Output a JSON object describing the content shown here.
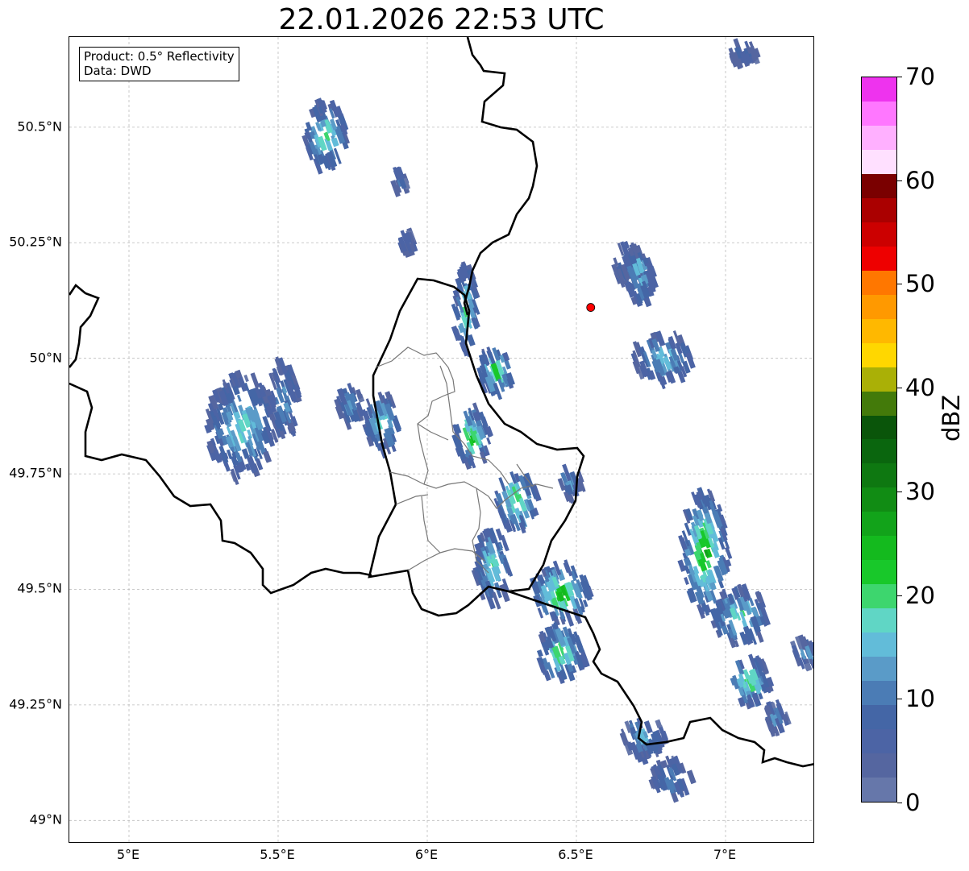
{
  "title": "22.01.2026 22:53 UTC",
  "info_box": {
    "product": "Product: 0.5° Reflectivity",
    "data_source": "Data: DWD"
  },
  "map_extent": {
    "lon_min": 4.8,
    "lon_max": 7.3,
    "lat_min": 48.95,
    "lat_max": 50.695
  },
  "lat_ticks": [
    {
      "value": 50.5,
      "label": "50.5°N"
    },
    {
      "value": 50.25,
      "label": "50.25°N"
    },
    {
      "value": 50.0,
      "label": "50°N"
    },
    {
      "value": 49.75,
      "label": "49.75°N"
    },
    {
      "value": 49.5,
      "label": "49.5°N"
    },
    {
      "value": 49.25,
      "label": "49.25°N"
    },
    {
      "value": 49.0,
      "label": "49°N"
    }
  ],
  "lon_ticks": [
    {
      "value": 5.0,
      "label": "5°E"
    },
    {
      "value": 5.5,
      "label": "5.5°E"
    },
    {
      "value": 6.0,
      "label": "6°E"
    },
    {
      "value": 6.5,
      "label": "6.5°E"
    },
    {
      "value": 7.0,
      "label": "7°E"
    }
  ],
  "radar_site": {
    "lon": 6.548,
    "lat": 50.11,
    "color": "#ff0000"
  },
  "colorbar": {
    "label": "dBZ",
    "min": 0,
    "max": 70,
    "ticks": [
      "0",
      "10",
      "20",
      "30",
      "40",
      "50",
      "60",
      "70"
    ],
    "colors": [
      "#6677aa",
      "#5566a0",
      "#4c64a5",
      "#4466a6",
      "#4b7cb5",
      "#5a9bc8",
      "#62bcd9",
      "#60d6c5",
      "#3dd66e",
      "#18c82a",
      "#14ba1e",
      "#12a31a",
      "#118c14",
      "#0e7811",
      "#0a660e",
      "#0a550a",
      "#437a0a",
      "#aab006",
      "#ffd700",
      "#ffb800",
      "#ff9900",
      "#ff7700",
      "#ee0000",
      "#cc0000",
      "#aa0000",
      "#7a0000",
      "#ffe0ff",
      "#ffb0ff",
      "#ff77ff",
      "#ee33ee"
    ]
  },
  "echo_clusters": [
    {
      "lon": 5.66,
      "lat": 50.48,
      "rx": 0.07,
      "ry": 0.07,
      "peak": 22
    },
    {
      "lon": 5.91,
      "lat": 50.38,
      "rx": 0.02,
      "ry": 0.03,
      "peak": 10
    },
    {
      "lon": 5.93,
      "lat": 50.25,
      "rx": 0.03,
      "ry": 0.02,
      "peak": 10
    },
    {
      "lon": 5.38,
      "lat": 49.85,
      "rx": 0.12,
      "ry": 0.11,
      "peak": 18
    },
    {
      "lon": 5.52,
      "lat": 49.91,
      "rx": 0.05,
      "ry": 0.08,
      "peak": 15
    },
    {
      "lon": 5.85,
      "lat": 49.86,
      "rx": 0.06,
      "ry": 0.06,
      "peak": 20
    },
    {
      "lon": 5.74,
      "lat": 49.9,
      "rx": 0.04,
      "ry": 0.04,
      "peak": 16
    },
    {
      "lon": 6.13,
      "lat": 50.1,
      "rx": 0.04,
      "ry": 0.1,
      "peak": 20
    },
    {
      "lon": 6.23,
      "lat": 49.97,
      "rx": 0.06,
      "ry": 0.05,
      "peak": 22
    },
    {
      "lon": 6.15,
      "lat": 49.83,
      "rx": 0.06,
      "ry": 0.06,
      "peak": 24
    },
    {
      "lon": 6.3,
      "lat": 49.69,
      "rx": 0.07,
      "ry": 0.06,
      "peak": 24
    },
    {
      "lon": 6.22,
      "lat": 49.55,
      "rx": 0.06,
      "ry": 0.08,
      "peak": 20
    },
    {
      "lon": 6.45,
      "lat": 49.49,
      "rx": 0.1,
      "ry": 0.06,
      "peak": 26
    },
    {
      "lon": 6.48,
      "lat": 49.73,
      "rx": 0.04,
      "ry": 0.03,
      "peak": 15
    },
    {
      "lon": 6.45,
      "lat": 49.36,
      "rx": 0.08,
      "ry": 0.06,
      "peak": 22
    },
    {
      "lon": 6.73,
      "lat": 49.18,
      "rx": 0.07,
      "ry": 0.04,
      "peak": 16
    },
    {
      "lon": 6.82,
      "lat": 49.09,
      "rx": 0.07,
      "ry": 0.04,
      "peak": 14
    },
    {
      "lon": 6.68,
      "lat": 50.2,
      "rx": 0.05,
      "ry": 0.05,
      "peak": 14
    },
    {
      "lon": 6.71,
      "lat": 50.18,
      "rx": 0.05,
      "ry": 0.06,
      "peak": 18
    },
    {
      "lon": 6.79,
      "lat": 50.0,
      "rx": 0.1,
      "ry": 0.05,
      "peak": 18
    },
    {
      "lon": 6.93,
      "lat": 49.58,
      "rx": 0.08,
      "ry": 0.13,
      "peak": 26
    },
    {
      "lon": 7.05,
      "lat": 49.44,
      "rx": 0.1,
      "ry": 0.06,
      "peak": 20
    },
    {
      "lon": 7.08,
      "lat": 49.3,
      "rx": 0.07,
      "ry": 0.05,
      "peak": 22
    },
    {
      "lon": 7.17,
      "lat": 49.22,
      "rx": 0.04,
      "ry": 0.03,
      "peak": 14
    },
    {
      "lon": 7.27,
      "lat": 49.36,
      "rx": 0.04,
      "ry": 0.03,
      "peak": 14
    },
    {
      "lon": 7.06,
      "lat": 50.66,
      "rx": 0.05,
      "ry": 0.02,
      "peak": 10
    }
  ]
}
